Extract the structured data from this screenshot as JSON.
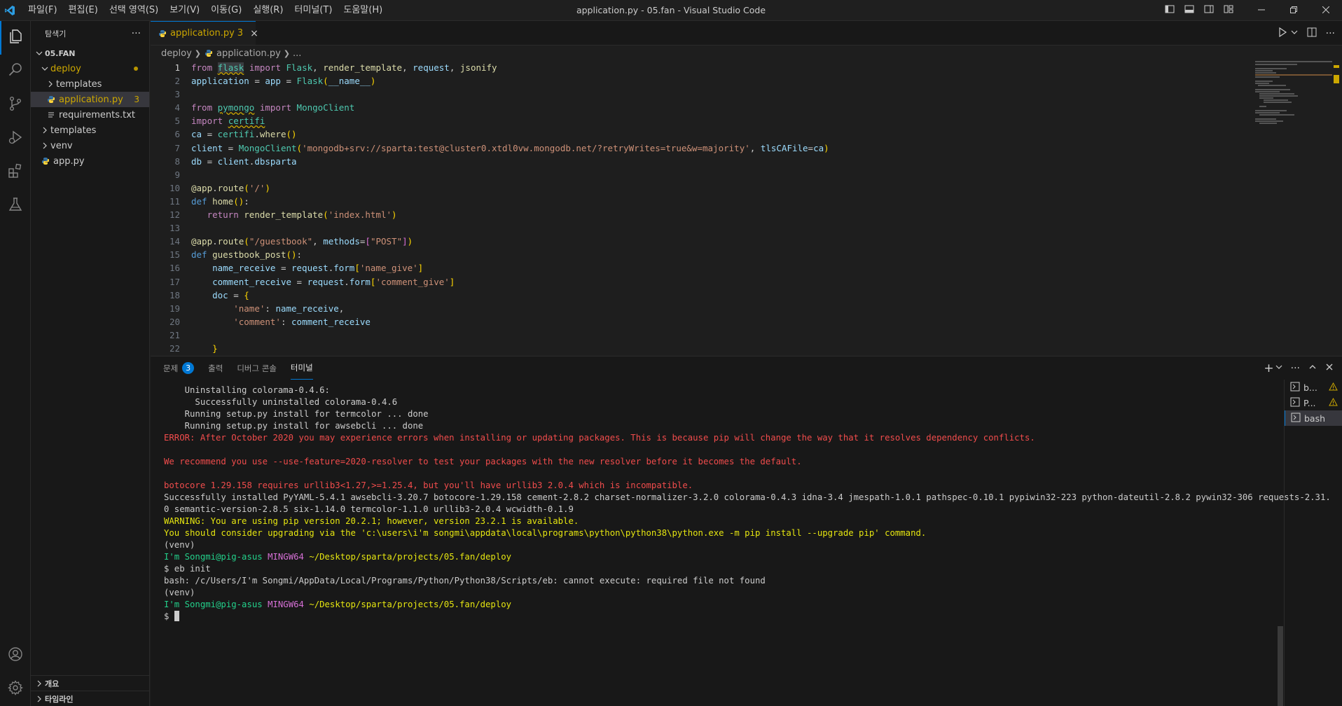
{
  "window": {
    "title": "application.py - 05.fan - Visual Studio Code",
    "menu": [
      "파일(F)",
      "편집(E)",
      "선택 영역(S)",
      "보기(V)",
      "이동(G)",
      "실행(R)",
      "터미널(T)",
      "도움말(H)"
    ]
  },
  "sidebar": {
    "title": "탐색기",
    "more": "···",
    "root": "05.FAN",
    "items": [
      {
        "label": "deploy",
        "type": "folder-open"
      },
      {
        "label": "templates",
        "type": "folder"
      },
      {
        "label": "application.py",
        "type": "python",
        "badge": "3"
      },
      {
        "label": "requirements.txt",
        "type": "text"
      },
      {
        "label": "templates",
        "type": "folder"
      },
      {
        "label": "venv",
        "type": "folder"
      },
      {
        "label": "app.py",
        "type": "python"
      }
    ],
    "outline": "개요",
    "timeline": "타임라인"
  },
  "editor": {
    "tab": {
      "label": "application.py",
      "count": "3",
      "close": "×"
    },
    "breadcrumb": [
      "deploy",
      "application.py",
      "..."
    ],
    "line_numbers": [
      "1",
      "2",
      "3",
      "4",
      "5",
      "6",
      "7",
      "8",
      "9",
      "10",
      "11",
      "12",
      "13",
      "14",
      "15",
      "16",
      "17",
      "18",
      "19",
      "20",
      "21",
      "22"
    ]
  },
  "panel": {
    "tabs": [
      {
        "label": "문제",
        "badge": "3"
      },
      {
        "label": "출력"
      },
      {
        "label": "디버그 콘솔"
      },
      {
        "label": "터미널"
      }
    ],
    "add": "+",
    "more": "···",
    "terminals": [
      {
        "label": "b..."
      },
      {
        "label": "P..."
      },
      {
        "label": "bash"
      }
    ],
    "terminal_lines": [
      "    Uninstalling colorama-0.4.6:",
      "      Successfully uninstalled colorama-0.4.6",
      "    Running setup.py install for termcolor ... done",
      "    Running setup.py install for awsebcli ... done",
      "ERROR: After October 2020 you may experience errors when installing or updating packages. This is because pip will change the way that it resolves dependency conflicts.",
      "",
      "We recommend you use --use-feature=2020-resolver to test your packages with the new resolver before it becomes the default.",
      "",
      "botocore 1.29.158 requires urllib3<1.27,>=1.25.4, but you'll have urllib3 2.0.4 which is incompatible.",
      "Successfully installed PyYAML-5.4.1 awsebcli-3.20.7 botocore-1.29.158 cement-2.8.2 charset-normalizer-3.2.0 colorama-0.4.3 idna-3.4 jmespath-1.0.1 pathspec-0.10.1 pypiwin32-223 python-dateutil-2.8.2 pywin32-306 requests-2.31.",
      "0 semantic-version-2.8.5 six-1.14.0 termcolor-1.1.0 urllib3-2.0.4 wcwidth-0.1.9",
      "WARNING: You are using pip version 20.2.1; however, version 23.2.1 is available.",
      "You should consider upgrading via the 'c:\\users\\i'm songmi\\appdata\\local\\programs\\python\\python38\\python.exe -m pip install --upgrade pip' command.",
      "(venv)",
      "",
      "$ eb init",
      "bash: /c/Users/I'm Songmi/AppData/Local/Programs/Python/Python38/Scripts/eb: cannot execute: required file not found",
      "(venv)",
      "",
      "$ "
    ],
    "prompt": {
      "user": "I'm Songmi@pig-asus",
      "shell": "MINGW64",
      "path": "~/Desktop/sparta/projects/05.fan/deploy"
    }
  },
  "colors": {
    "accent": "#0078d4",
    "warning": "#cca700",
    "error": "#f14c4c"
  }
}
